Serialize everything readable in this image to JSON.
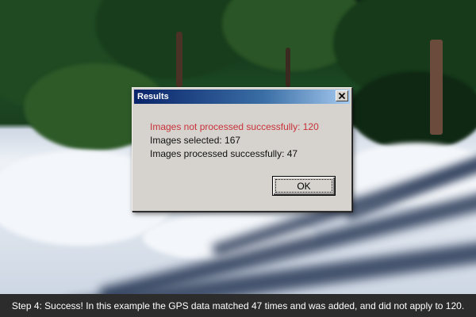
{
  "dialog": {
    "title": "Results",
    "messages": {
      "error": "Images not processed successfully: 120",
      "selected": "Images selected: 167",
      "success": "Images processed successfully: 47"
    },
    "ok_label": "OK",
    "close_icon": "close-icon",
    "error_color": "#c8323a",
    "title_gradient": [
      "#0a246a",
      "#a6caf0"
    ]
  },
  "caption": {
    "text": "Step 4: Success! In this example the GPS data matched 47 times and was added, and did not apply to 120."
  }
}
